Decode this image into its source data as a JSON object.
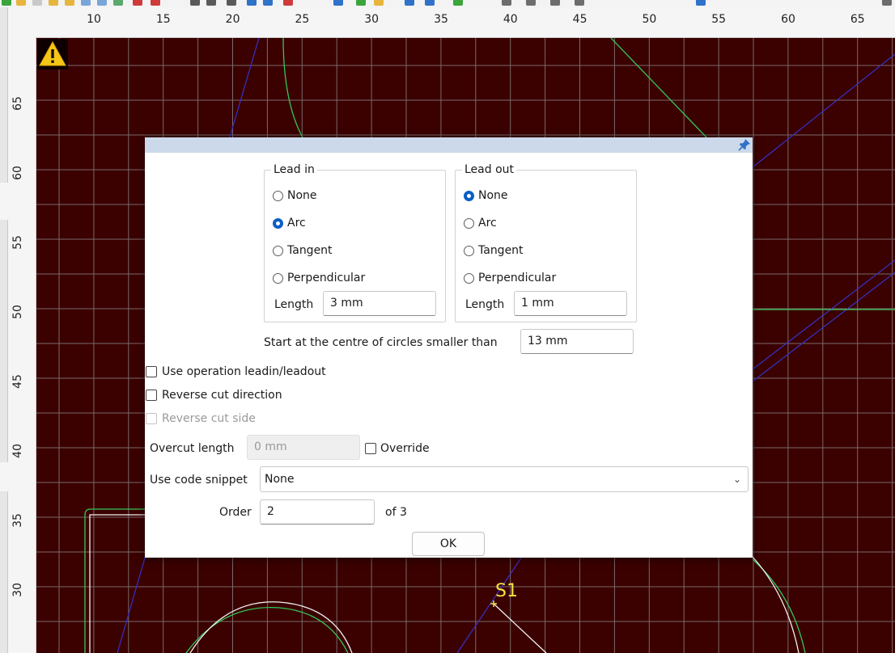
{
  "ruler": {
    "top_ticks": [
      "10",
      "15",
      "20",
      "25",
      "30",
      "35",
      "40",
      "45",
      "50",
      "55",
      "60",
      "65"
    ],
    "left_ticks": [
      "65",
      "60",
      "55",
      "50",
      "45",
      "40",
      "35",
      "30"
    ]
  },
  "canvas": {
    "background": "#3b0000",
    "grid_color": "#7a6a6a",
    "start_marker_label": "S1",
    "warning_icon": "warning-icon"
  },
  "dialog": {
    "pin_icon": "pin-icon",
    "lead_in": {
      "title": "Lead in",
      "options": [
        "None",
        "Arc",
        "Tangent",
        "Perpendicular"
      ],
      "selected": "Arc",
      "length_label": "Length",
      "length_value": "3 mm"
    },
    "lead_out": {
      "title": "Lead out",
      "options": [
        "None",
        "Arc",
        "Tangent",
        "Perpendicular"
      ],
      "selected": "None",
      "length_label": "Length",
      "length_value": "1 mm"
    },
    "circle_label": "Start at the centre of circles smaller than",
    "circle_value": "13 mm",
    "use_op_leadin": "Use operation leadin/leadout",
    "reverse_direction": "Reverse cut direction",
    "reverse_side": "Reverse cut side",
    "overcut_label": "Overcut length",
    "overcut_value": "0 mm",
    "override_label": "Override",
    "snippet_label": "Use code snippet",
    "snippet_value": "None",
    "order_label": "Order",
    "order_value": "2",
    "order_of": "of 3",
    "ok_label": "OK"
  }
}
